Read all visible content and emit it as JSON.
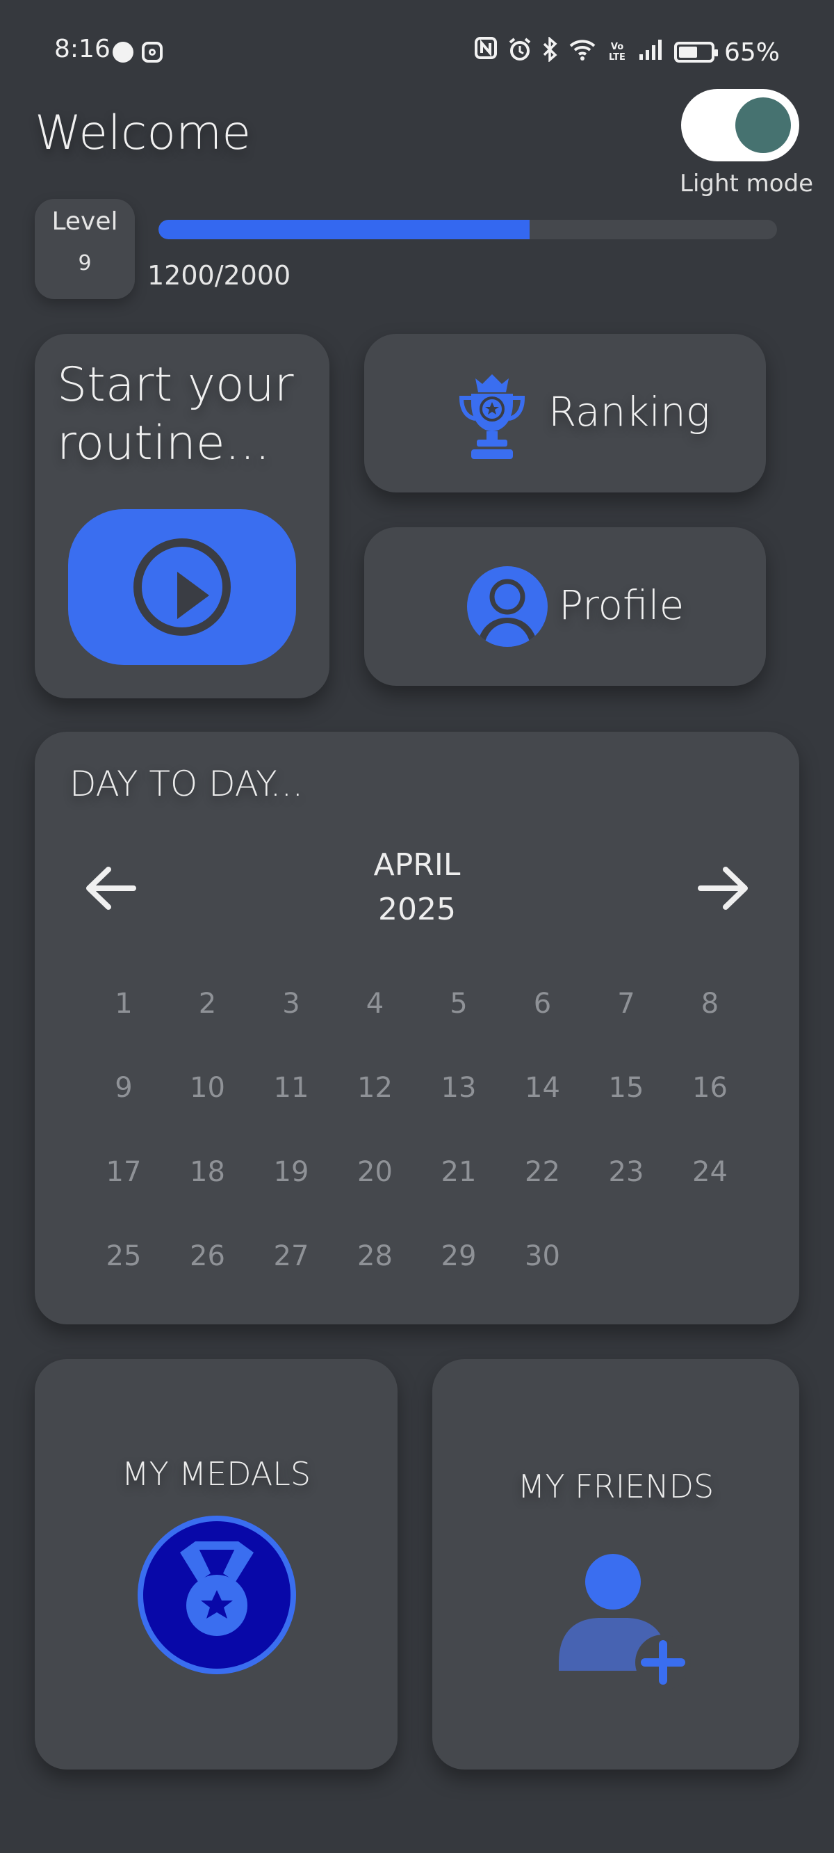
{
  "status_bar": {
    "time": "8:16",
    "battery_percent": "65%",
    "battery_level": 0.65,
    "left_icons": [
      "notification-face-icon",
      "instagram-icon"
    ],
    "right_icons": [
      "nfc-icon",
      "alarm-icon",
      "bluetooth-icon",
      "wifi-icon",
      "volte-icon",
      "signal-icon",
      "battery-icon"
    ],
    "volte_label": "Vo LTE"
  },
  "header": {
    "title": "Welcome",
    "theme_toggle_label": "Light mode",
    "toggle_color": "#467270"
  },
  "level": {
    "label": "Level",
    "value": "9",
    "xp_text": "1200/2000",
    "xp_fraction": 0.6
  },
  "start_routine": {
    "title_line1": "Start your",
    "title_line2": "routine...",
    "icon": "play-icon"
  },
  "nav": {
    "ranking_label": "Ranking",
    "ranking_icon": "trophy-icon",
    "profile_label": "Profile",
    "profile_icon": "user-icon"
  },
  "calendar": {
    "title": "DAY TO DAY...",
    "month": "APRIL",
    "year": "2025",
    "days": [
      "1",
      "2",
      "3",
      "4",
      "5",
      "6",
      "7",
      "8",
      "9",
      "10",
      "11",
      "12",
      "13",
      "14",
      "15",
      "16",
      "17",
      "18",
      "19",
      "20",
      "21",
      "22",
      "23",
      "24",
      "25",
      "26",
      "27",
      "28",
      "29",
      "30"
    ]
  },
  "medals": {
    "title": "MY MEDALS",
    "icon": "medal-icon"
  },
  "friends": {
    "title": "MY FRIENDS",
    "icon": "add-friend-icon"
  },
  "colors": {
    "background": "#36393e",
    "card": "#45484d",
    "accent": "#3a6ef0",
    "medal_fill": "#0808a8"
  }
}
